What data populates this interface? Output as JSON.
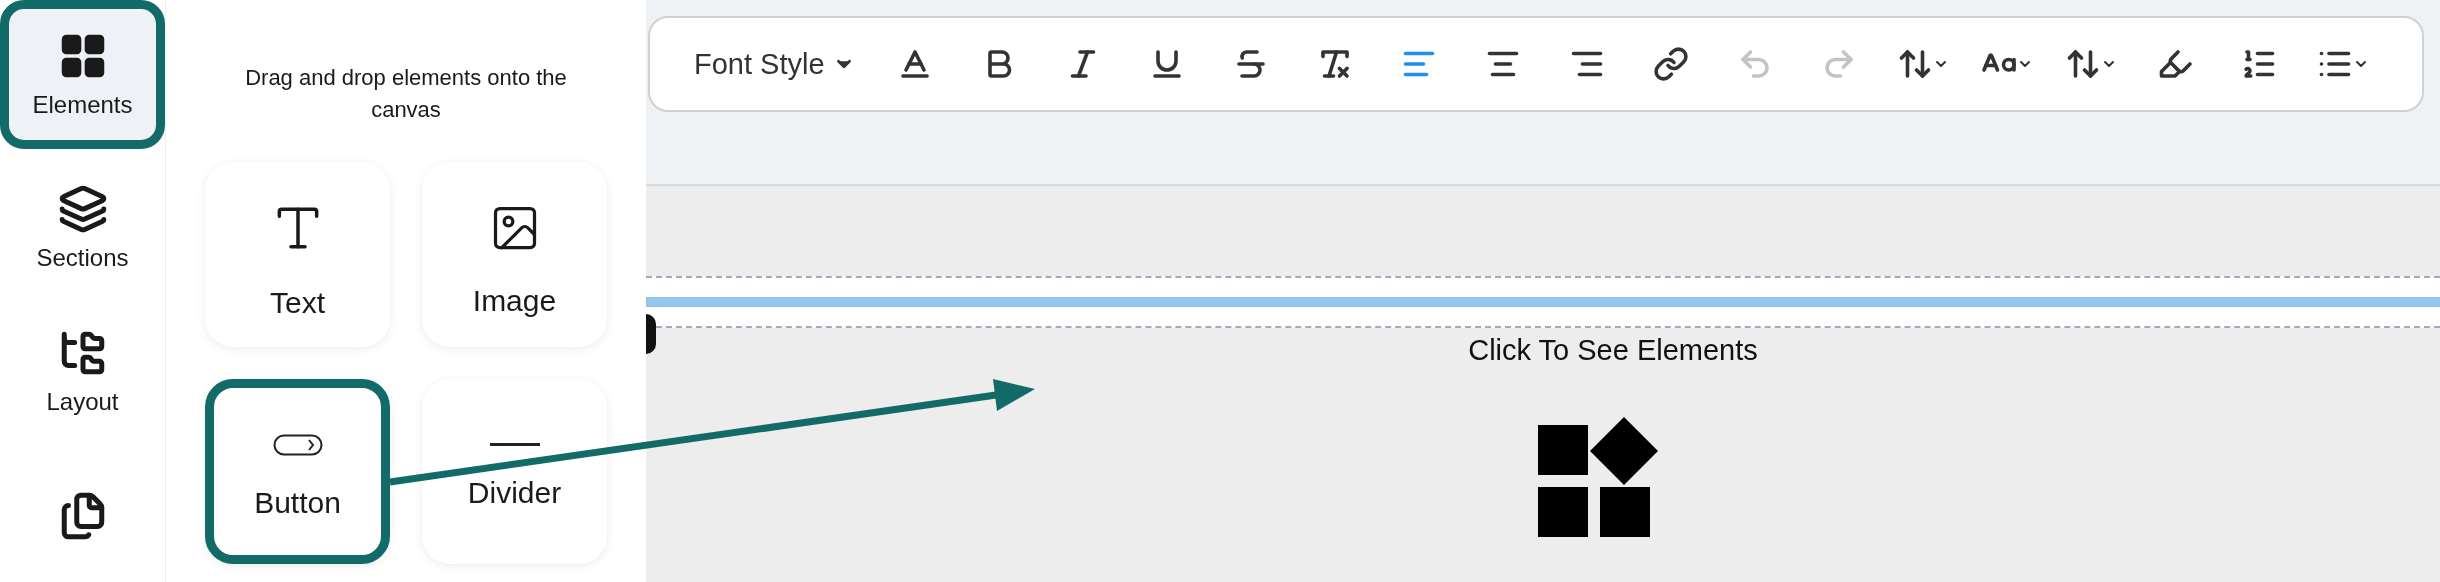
{
  "sidebar": {
    "items": [
      {
        "kind": "elements",
        "label": "Elements",
        "selected": true,
        "highlighted": true
      },
      {
        "kind": "sections",
        "label": "Sections",
        "selected": false,
        "highlighted": false
      },
      {
        "kind": "layout",
        "label": "Layout",
        "selected": false,
        "highlighted": false
      },
      {
        "kind": "pages",
        "selected": false,
        "highlighted": false
      }
    ]
  },
  "panel": {
    "hint": "Drag and drop elements onto the canvas",
    "elements": [
      {
        "kind": "text",
        "label": "Text",
        "highlighted": false
      },
      {
        "kind": "image",
        "label": "Image",
        "highlighted": false
      },
      {
        "kind": "button",
        "label": "Button",
        "highlighted": true
      },
      {
        "kind": "divider",
        "label": "Divider",
        "highlighted": false
      }
    ]
  },
  "toolbar": {
    "font_style": "Font Style",
    "tools": [
      {
        "kind": "text-color",
        "active": false,
        "disabled": false,
        "menu": false
      },
      {
        "kind": "bold",
        "active": false,
        "disabled": false,
        "menu": false
      },
      {
        "kind": "italic",
        "active": false,
        "disabled": false,
        "menu": false
      },
      {
        "kind": "underline",
        "active": false,
        "disabled": false,
        "menu": false
      },
      {
        "kind": "strikethrough",
        "active": false,
        "disabled": false,
        "menu": false
      },
      {
        "kind": "clear-format",
        "active": false,
        "disabled": false,
        "menu": false
      },
      {
        "kind": "align-left",
        "active": true,
        "disabled": false,
        "menu": false
      },
      {
        "kind": "align-center",
        "active": false,
        "disabled": false,
        "menu": false
      },
      {
        "kind": "align-right",
        "active": false,
        "disabled": false,
        "menu": false
      },
      {
        "kind": "link",
        "active": false,
        "disabled": false,
        "menu": false
      },
      {
        "kind": "undo",
        "active": false,
        "disabled": true,
        "menu": false
      },
      {
        "kind": "redo",
        "active": false,
        "disabled": true,
        "menu": false
      },
      {
        "kind": "line-height",
        "active": false,
        "disabled": false,
        "menu": true
      },
      {
        "kind": "font-size",
        "active": false,
        "disabled": false,
        "menu": true
      },
      {
        "kind": "spacing",
        "active": false,
        "disabled": false,
        "menu": true
      },
      {
        "kind": "highlighter",
        "active": false,
        "disabled": false,
        "menu": false
      },
      {
        "kind": "ordered-list",
        "active": false,
        "disabled": false,
        "menu": false
      },
      {
        "kind": "bullet-list",
        "active": false,
        "disabled": false,
        "menu": true
      }
    ]
  },
  "canvas": {
    "prompt": "Click To See Elements"
  }
}
